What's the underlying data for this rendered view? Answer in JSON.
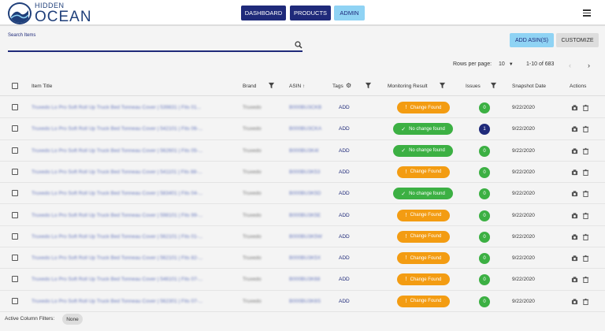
{
  "app": {
    "logo_line1": "HIDDEN",
    "logo_line2": "OCEAN",
    "colors": {
      "primary": "#1f2a7a",
      "accent": "#8fd3f4",
      "change": "#f39c12",
      "nochange": "#3cb043"
    }
  },
  "nav": {
    "dashboard": "DASHBOARD",
    "products": "PRODUCTS",
    "admin": "ADMIN"
  },
  "search": {
    "label": "Search Items",
    "value": ""
  },
  "toolbar": {
    "add_asin": "ADD ASIN(S)",
    "customize": "CUSTOMIZE"
  },
  "pagination": {
    "rows_per_page_label": "Rows per page:",
    "rows_per_page_value": "10",
    "range": "1-10 of 683"
  },
  "table": {
    "headers": {
      "item_title": "Item Title",
      "brand": "Brand",
      "asin": "ASIN",
      "tags": "Tags",
      "monitoring": "Monitoring Result",
      "issues": "Issues",
      "snapshot": "Snapshot Date",
      "actions": "Actions"
    },
    "rows": [
      {
        "title": "Truxedo Lo Pro Soft Roll Up Truck Bed Tonneau Cover | 539831 | Fits 01...",
        "brand": "Truxedo",
        "asin": "B000BU3CKB",
        "tag": "ADD",
        "status": "Change Found",
        "status_type": "change",
        "issues": "0",
        "date": "9/22/2020"
      },
      {
        "title": "Truxedo Lo Pro Soft Roll Up Truck Bed Tonneau Cover | 542101 | Fits 06-...",
        "brand": "Truxedo",
        "asin": "B000BU3CKA",
        "tag": "ADD",
        "status": "No change found",
        "status_type": "nochange",
        "issues": "1",
        "date": "9/22/2020"
      },
      {
        "title": "Truxedo Lo Pro Soft Roll Up Truck Bed Tonneau Cover | 562601 | Fits 05-...",
        "brand": "Truxedo",
        "asin": "B000BU3K4I",
        "tag": "ADD",
        "status": "No change found",
        "status_type": "nochange",
        "issues": "0",
        "date": "9/22/2020"
      },
      {
        "title": "Truxedo Lo Pro Soft Roll Up Truck Bed Tonneau Cover | 541101 | Fits 88-...",
        "brand": "Truxedo",
        "asin": "B000BU3K53",
        "tag": "ADD",
        "status": "Change Found",
        "status_type": "change",
        "issues": "0",
        "date": "9/22/2020"
      },
      {
        "title": "Truxedo Lo Pro Soft Roll Up Truck Bed Tonneau Cover | 583401 | Fits 04-...",
        "brand": "Truxedo",
        "asin": "B000BU3K5D",
        "tag": "ADD",
        "status": "No change found",
        "status_type": "nochange",
        "issues": "0",
        "date": "9/22/2020"
      },
      {
        "title": "Truxedo Lo Pro Soft Roll Up Truck Bed Tonneau Cover | 598101 | Fits 99-...",
        "brand": "Truxedo",
        "asin": "B000BU3K5E",
        "tag": "ADD",
        "status": "Change Found",
        "status_type": "change",
        "issues": "0",
        "date": "9/22/2020"
      },
      {
        "title": "Truxedo Lo Pro Soft Roll Up Truck Bed Tonneau Cover | 562101 | Fits 01-...",
        "brand": "Truxedo",
        "asin": "B000BU3K5W",
        "tag": "ADD",
        "status": "Change Found",
        "status_type": "change",
        "issues": "0",
        "date": "9/22/2020"
      },
      {
        "title": "Truxedo Lo Pro Soft Roll Up Truck Bed Tonneau Cover | 562101 | Fits 82-...",
        "brand": "Truxedo",
        "asin": "B000BU3K5X",
        "tag": "ADD",
        "status": "Change Found",
        "status_type": "change",
        "issues": "0",
        "date": "9/22/2020"
      },
      {
        "title": "Truxedo Lo Pro Soft Roll Up Truck Bed Tonneau Cover | 546101 | Fits 07-...",
        "brand": "Truxedo",
        "asin": "B000BU3K68",
        "tag": "ADD",
        "status": "Change Found",
        "status_type": "change",
        "issues": "0",
        "date": "9/22/2020"
      },
      {
        "title": "Truxedo Lo Pro Soft Roll Up Truck Bed Tonneau Cover | 562301 | Fits 07-...",
        "brand": "Truxedo",
        "asin": "B000BU3K6S",
        "tag": "ADD",
        "status": "Change Found",
        "status_type": "change",
        "issues": "0",
        "date": "9/22/2020"
      }
    ]
  },
  "footer": {
    "label": "Active Column Filters:",
    "chip": "None"
  }
}
